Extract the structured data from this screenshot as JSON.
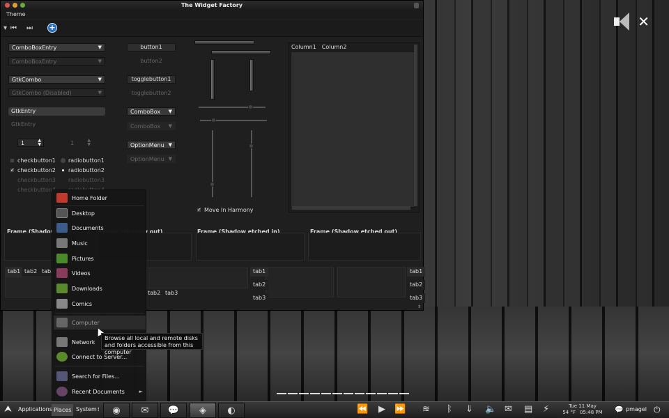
{
  "window": {
    "title": "The Widget Factory",
    "menu": "Theme"
  },
  "toolbar": {
    "first_icon": "skip-back-icon",
    "last_icon": "skip-forward-icon",
    "add_icon": "add-icon"
  },
  "col1": {
    "combo_entry": "ComboBoxEntry",
    "combo_entry_dis": "ComboBoxEntry",
    "gtk_combo": "GtkCombo",
    "gtk_combo_dis": "GtkCombo (Disabled)",
    "entry": "GtkEntry",
    "entry_dis": "GtkEntry",
    "spin": "1",
    "spin_dis": "1",
    "check1": "checkbutton1",
    "check2": "checkbutton2",
    "check3": "checkbutton3",
    "check4": "checkbutton4",
    "radio1": "radiobutton1",
    "radio2": "radiobutton2",
    "radio3": "radiobutton3",
    "radio4": "radiobutton4"
  },
  "col2": {
    "button1": "button1",
    "button2": "button2",
    "toggle1": "togglebutton1",
    "toggle2": "togglebutton2",
    "combo": "ComboBox",
    "combo_dis": "ComboBox",
    "option": "OptionMenu",
    "option_dis": "OptionMenu"
  },
  "col3": {
    "harmony": "Move In Harmony"
  },
  "tree": {
    "columns": [
      "Column1",
      "Column2"
    ]
  },
  "frames": {
    "f1": "Frame (Shadow in)",
    "f2": "Frame (Shadow out)",
    "f3": "Frame (Shadow etched in)",
    "f4": "Frame (Shadow etched out)"
  },
  "tabs": [
    "tab1",
    "tab2",
    "tab3"
  ],
  "places_menu": {
    "items": [
      {
        "label": "Home Folder",
        "icon": "home-folder-icon",
        "color": "#c0392b"
      },
      {
        "label": "Desktop",
        "icon": "desktop-icon",
        "color": "#555555"
      },
      {
        "label": "Documents",
        "icon": "documents-icon",
        "color": "#3b5b8a"
      },
      {
        "label": "Music",
        "icon": "music-icon",
        "color": "#777777"
      },
      {
        "label": "Pictures",
        "icon": "pictures-icon",
        "color": "#4a8a2a"
      },
      {
        "label": "Videos",
        "icon": "videos-icon",
        "color": "#8a3a5a"
      },
      {
        "label": "Downloads",
        "icon": "downloads-icon",
        "color": "#5a8a2a"
      },
      {
        "label": "Comics",
        "icon": "comics-icon",
        "color": "#888888"
      },
      {
        "label": "Computer",
        "icon": "computer-icon",
        "color": "#666666"
      },
      {
        "label": "Network",
        "icon": "network-icon",
        "color": "#777777"
      },
      {
        "label": "Connect to Server...",
        "icon": "connect-server-icon",
        "color": "#5a8a2a"
      },
      {
        "label": "Search for Files...",
        "icon": "search-files-icon",
        "color": "#555577"
      },
      {
        "label": "Recent Documents",
        "icon": "recent-documents-icon",
        "color": "#664466"
      }
    ]
  },
  "tooltip": "Browse all local and remote disks and folders accessible from this computer",
  "panel": {
    "applications": "Applications",
    "places": "Places",
    "system": "System",
    "clock_date": "Tue 11 May",
    "clock_time": "05:48 PM",
    "temp": "54 °F",
    "user": "pmagel"
  }
}
